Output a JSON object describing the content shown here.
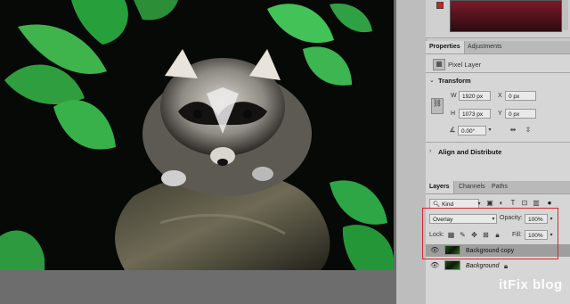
{
  "properties_panel": {
    "tabs": [
      "Properties",
      "Adjustments"
    ],
    "layer_type": "Pixel Layer",
    "transform": {
      "title": "Transform",
      "w_label": "W",
      "w_value": "1920 px",
      "h_label": "H",
      "h_value": "1073 px",
      "x_label": "X",
      "x_value": "0 px",
      "y_label": "Y",
      "y_value": "0 px",
      "angle_value": "0.00°"
    },
    "align_title": "Align and Distribute"
  },
  "layers_panel": {
    "tabs": [
      "Layers",
      "Channels",
      "Paths"
    ],
    "filter_value": "Kind",
    "blend_mode": "Overlay",
    "opacity_label": "Opacity:",
    "opacity_value": "100%",
    "lock_label": "Lock:",
    "fill_label": "Fill:",
    "fill_value": "100%",
    "layers": [
      {
        "name": "Background copy",
        "selected": true
      },
      {
        "name": "Background",
        "selected": false
      }
    ]
  },
  "watermark": "itFix blog",
  "colors": {
    "highlight_box": "#d62a2a",
    "swatch_top": "#7a1a2a"
  }
}
